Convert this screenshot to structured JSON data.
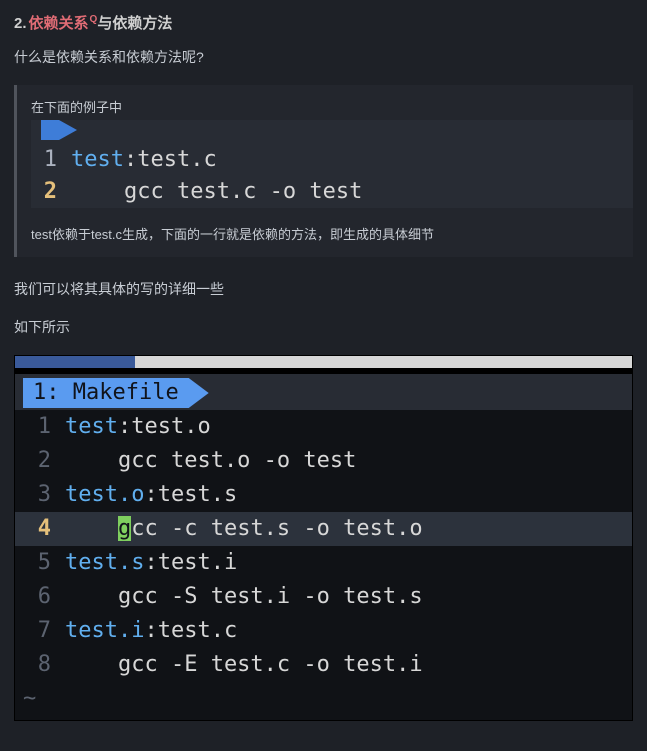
{
  "heading": {
    "num": "2.",
    "red": "依赖关系",
    "sup": "Q",
    "tail": "与依赖方法"
  },
  "intro": "什么是依赖关系和依赖方法呢?",
  "quote": {
    "caption": "在下面的例子中",
    "code_tab_truncated": "         ",
    "note": "test依赖于test.c生成，下面的一行就是依赖的方法，即生成的具体细节"
  },
  "code1": {
    "lines": [
      {
        "ln": "1",
        "current": false,
        "target": "test",
        "colon": ":",
        "dep": "test.c",
        "cmd": ""
      },
      {
        "ln": "2",
        "current": true,
        "target": "",
        "colon": "",
        "dep": "",
        "cmd": "    gcc test.c -o test"
      }
    ]
  },
  "para2": "我们可以将其具体的写的详细一些",
  "para3": "如下所示",
  "code2": {
    "tab": "1: Makefile",
    "lines": [
      {
        "ln": "1",
        "cur": false,
        "hl": false,
        "tgt": "test",
        "dep": "test.o",
        "cmd": ""
      },
      {
        "ln": "2",
        "cur": false,
        "hl": false,
        "tgt": "",
        "dep": "",
        "cmd": "    gcc test.o -o test"
      },
      {
        "ln": "3",
        "cur": false,
        "hl": false,
        "tgt": "test.o",
        "dep": "test.s",
        "cmd": ""
      },
      {
        "ln": "4",
        "cur": true,
        "hl": true,
        "tgt": "",
        "dep": "",
        "cmd_pre": "    ",
        "cursor": "g",
        "cmd_post": "cc -c test.s -o test.o"
      },
      {
        "ln": "5",
        "cur": false,
        "hl": false,
        "tgt": "test.s",
        "dep": "test.i",
        "cmd": ""
      },
      {
        "ln": "6",
        "cur": false,
        "hl": false,
        "tgt": "",
        "dep": "",
        "cmd": "    gcc -S test.i -o test.s"
      },
      {
        "ln": "7",
        "cur": false,
        "hl": false,
        "tgt": "test.i",
        "dep": "test.c",
        "cmd": ""
      },
      {
        "ln": "8",
        "cur": false,
        "hl": false,
        "tgt": "",
        "dep": "",
        "cmd": "    gcc -E test.c -o test.i"
      }
    ],
    "tilde": "~"
  }
}
